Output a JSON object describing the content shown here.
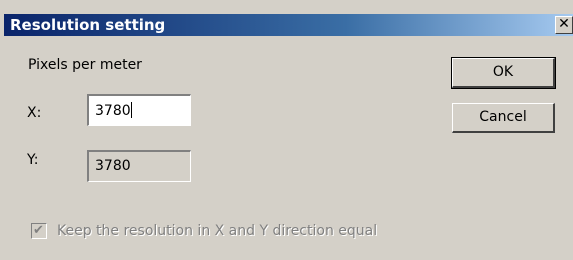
{
  "dialog": {
    "title": "Resolution setting",
    "close_glyph": "✕"
  },
  "form": {
    "group_label": "Pixels per meter",
    "x_label": "X:",
    "x_value": "3780",
    "y_label": "Y:",
    "y_value": "3780",
    "keep_equal_label": "Keep the resolution in X and Y direction equal",
    "keep_equal_checked": true,
    "keep_equal_enabled": false,
    "y_field_enabled": false
  },
  "buttons": {
    "ok_label": "OK",
    "cancel_label": "Cancel"
  },
  "colors": {
    "title_start": "#0a246a",
    "title_end": "#a6caf0",
    "face": "#d4d0c8",
    "disabled_text": "#808080"
  },
  "icons": {
    "close": "close-icon",
    "check": "checkmark-icon"
  }
}
